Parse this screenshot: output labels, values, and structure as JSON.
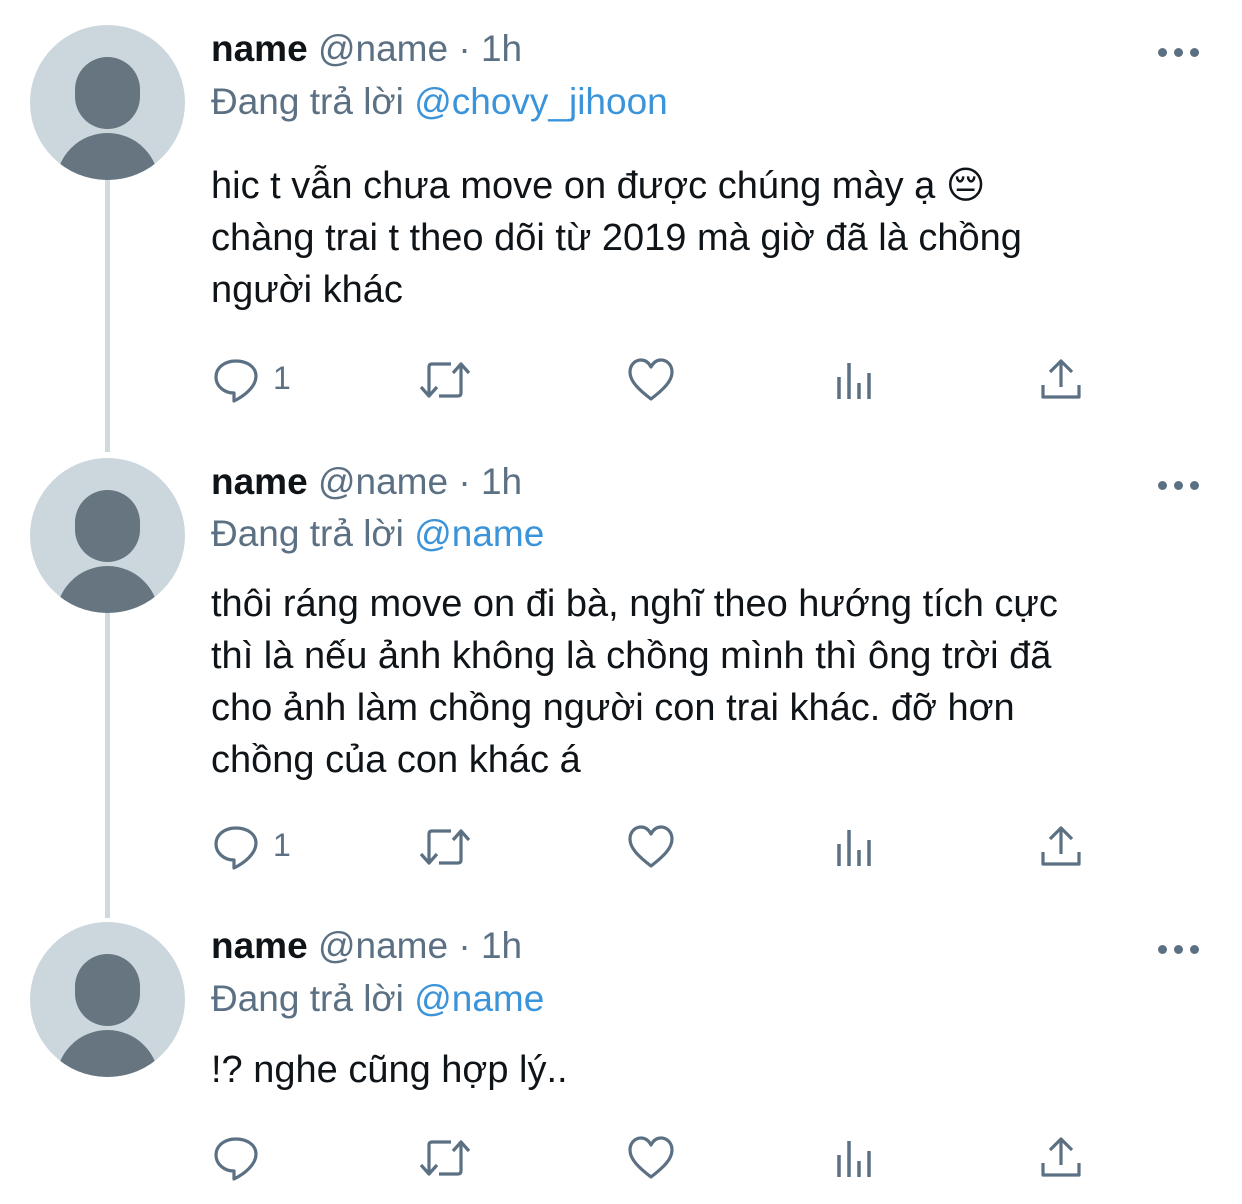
{
  "tweets": [
    {
      "display_name": "name",
      "handle": "@name",
      "separator": "·",
      "time": "1h",
      "replying_label": "Đang trả lời",
      "replying_to": "@chovy_jihoon",
      "text": "hic t vẫn chưa move on được chúng mày ạ 😔\nchàng trai t theo dõi từ 2019 mà giờ đã là chồng\nngười khác",
      "reply_count": "1",
      "icons": [
        "reply-icon",
        "retweet-icon",
        "like-icon",
        "analytics-icon",
        "share-icon"
      ]
    },
    {
      "display_name": "name",
      "handle": "@name",
      "separator": "·",
      "time": "1h",
      "replying_label": "Đang trả lời",
      "replying_to": "@name",
      "text": "thôi ráng move on đi bà, nghĩ theo hướng tích cực\nthì là nếu ảnh không là chồng mình thì ông trời đã\ncho ảnh làm chồng người con trai khác. đỡ hơn\nchồng của con khác á",
      "reply_count": "1",
      "icons": [
        "reply-icon",
        "retweet-icon",
        "like-icon",
        "analytics-icon",
        "share-icon"
      ]
    },
    {
      "display_name": "name",
      "handle": "@name",
      "separator": "·",
      "time": "1h",
      "replying_label": "Đang trả lời",
      "replying_to": "@name",
      "text": "!? nghe cũng hợp lý..",
      "reply_count": "",
      "icons": [
        "reply-icon",
        "retweet-icon",
        "like-icon",
        "analytics-icon",
        "share-icon"
      ]
    }
  ],
  "colors": {
    "text": "#0f1419",
    "secondary": "#5b7083",
    "mention": "#3b94d9",
    "avatar_bg": "#ccd6dd",
    "avatar_fg": "#66757f",
    "thread_line": "#cfd9de"
  }
}
